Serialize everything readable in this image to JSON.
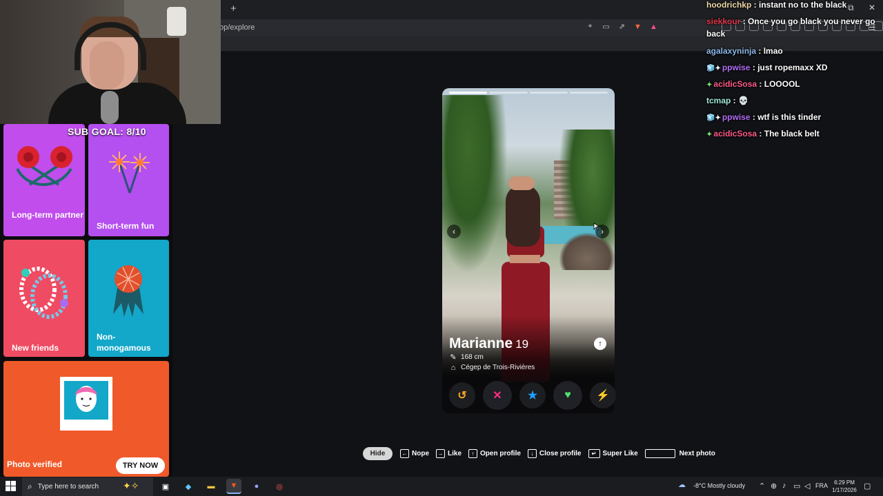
{
  "browser": {
    "new_tab": "+",
    "url": "op/explore",
    "window": {
      "restore": "⧉",
      "close": "✕",
      "menu": "☰"
    }
  },
  "stream": {
    "sub_goal": "SUB GOAL: 8/10"
  },
  "intents": [
    {
      "label": "Long-term partner",
      "color": "#c04dec"
    },
    {
      "label": "Short-term fun",
      "color": "#b44ff0"
    },
    {
      "label": "New friends",
      "color": "#ef4b63"
    },
    {
      "label": "Non-monogamous",
      "color": "#13a7c9"
    },
    {
      "label": "Photo verified",
      "color": "#f05a2a",
      "cta": "TRY NOW"
    }
  ],
  "profile": {
    "name": "Marianne",
    "age": "19",
    "height": "168 cm",
    "school": "Cégep de Trois-Rivières",
    "photo_count": 4,
    "active_photo": 1
  },
  "actions": [
    {
      "name": "rewind",
      "glyph": "↺",
      "color": "#f5a623"
    },
    {
      "name": "nope",
      "glyph": "✕",
      "color": "#ff2d87"
    },
    {
      "name": "super-like",
      "glyph": "★",
      "color": "#21a0ff"
    },
    {
      "name": "like",
      "glyph": "♥",
      "color": "#4fe36b"
    },
    {
      "name": "boost",
      "glyph": "⚡",
      "color": "#b54cff"
    }
  ],
  "hints": {
    "hide": "Hide",
    "nope": "Nope",
    "like": "Like",
    "open_profile": "Open profile",
    "close_profile": "Close profile",
    "super_like": "Super Like",
    "next_photo": "Next photo"
  },
  "chat": [
    {
      "user": "hoodrichkp",
      "color": "#f0d9a8",
      "text": "instant no to the black",
      "badges": ""
    },
    {
      "user": "siekkour",
      "color": "#e0364a",
      "text": "Once you go black you never go back",
      "badges": ""
    },
    {
      "user": "agalaxyninja",
      "color": "#8bb8e8",
      "text": "lmao",
      "badges": ""
    },
    {
      "user": "ppwise",
      "color": "#b16cf5",
      "text": "just ropemaxx XD",
      "badges": "🧊✦"
    },
    {
      "user": "acidicSosa",
      "color": "#ff5a88",
      "text": "LOOOOL",
      "badges": "✦"
    },
    {
      "user": "tcmap",
      "color": "#9ee6d7",
      "text": "💀",
      "badges": ""
    },
    {
      "user": "ppwise",
      "color": "#b16cf5",
      "text": "wtf is this tinder",
      "badges": "🧊✦"
    },
    {
      "user": "acidicSosa",
      "color": "#ff5a88",
      "text": "The black belt",
      "badges": "✦"
    }
  ],
  "taskbar": {
    "search_placeholder": "Type here to search",
    "weather": "-8°C  Mostly cloudy",
    "language": "FRA",
    "time": "6:29 PM",
    "date": "1/17/2026"
  }
}
